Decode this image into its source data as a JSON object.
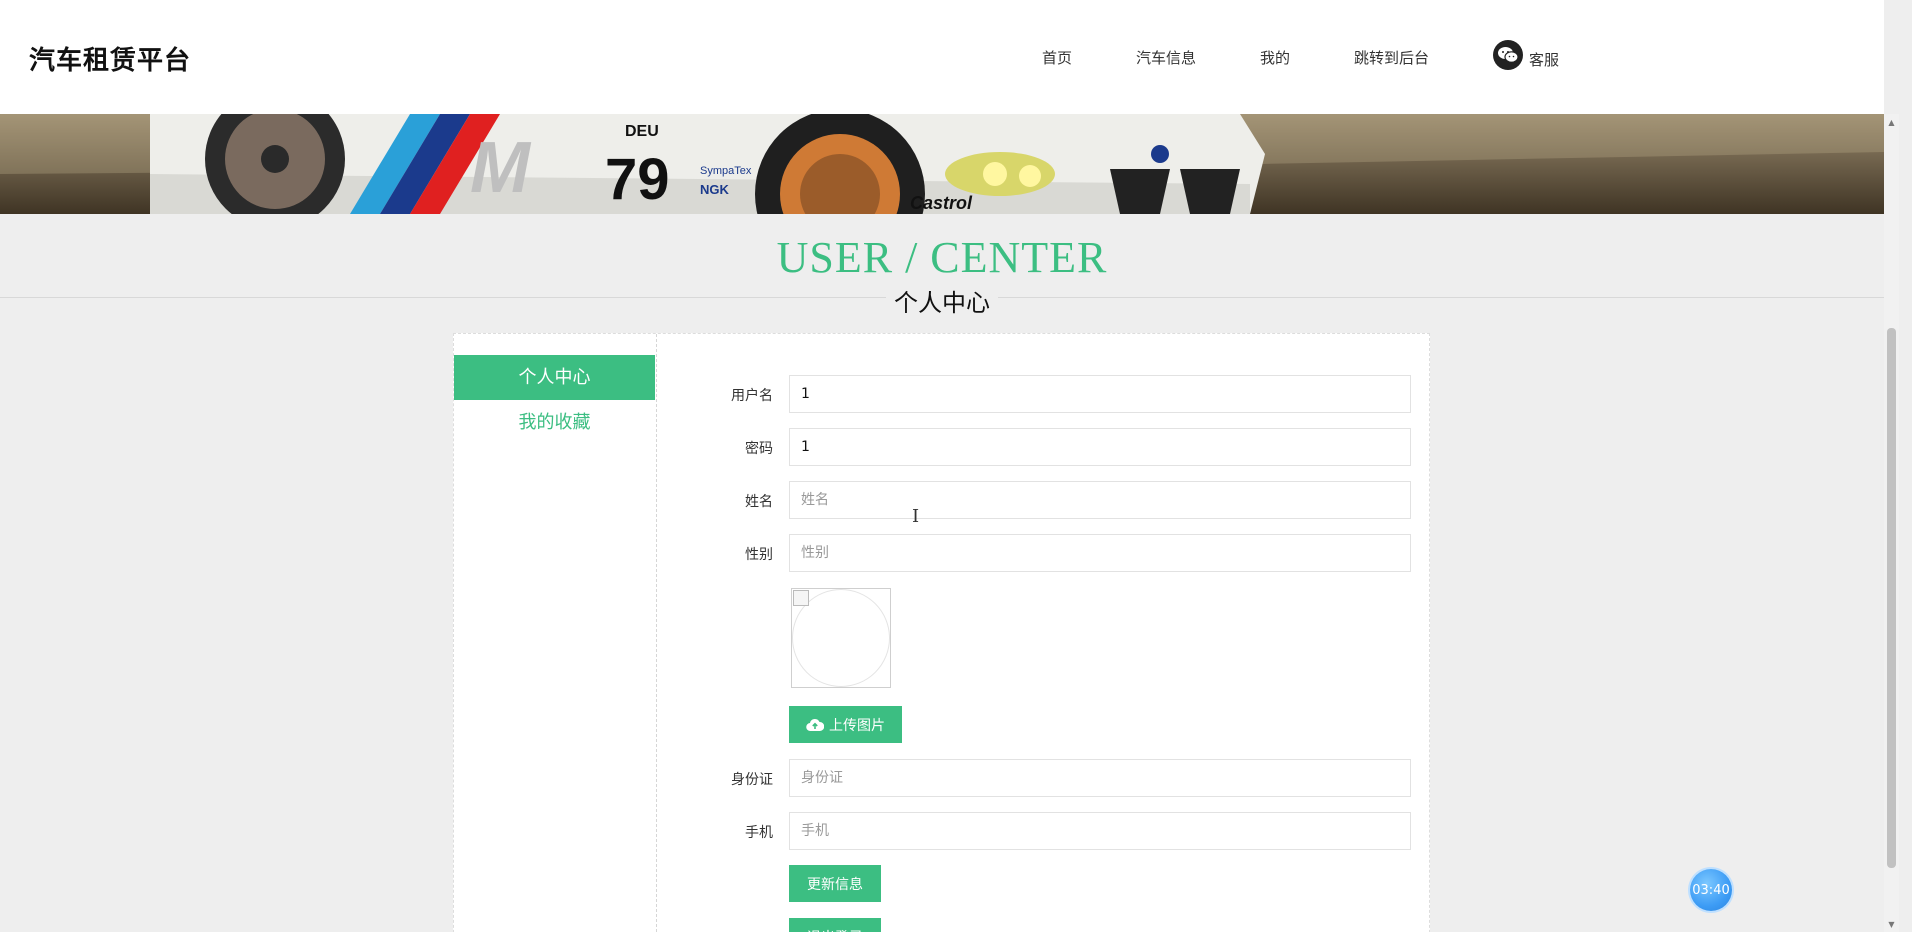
{
  "header": {
    "brand": "汽车租赁平台",
    "nav": [
      {
        "label": "首页"
      },
      {
        "label": "汽车信息"
      },
      {
        "label": "我的"
      },
      {
        "label": "跳转到后台"
      }
    ],
    "customer_service": {
      "label": "客服",
      "icon": "wechat-icon"
    }
  },
  "heading": {
    "english": "USER / CENTER",
    "chinese": "个人中心"
  },
  "sidebar": {
    "items": [
      {
        "label": "个人中心",
        "active": true
      },
      {
        "label": "我的收藏",
        "active": false
      }
    ]
  },
  "form": {
    "username": {
      "label": "用户名",
      "value": "1"
    },
    "password": {
      "label": "密码",
      "value": "1"
    },
    "name": {
      "label": "姓名",
      "value": "",
      "placeholder": "姓名"
    },
    "gender": {
      "label": "性别",
      "value": "",
      "placeholder": "性别"
    },
    "upload_button": "上传图片",
    "id_card": {
      "label": "身份证",
      "value": "",
      "placeholder": "身份证"
    },
    "phone": {
      "label": "手机",
      "value": "",
      "placeholder": "手机"
    },
    "update_button": "更新信息",
    "logout_button": "退出登录"
  },
  "timer": {
    "value": "03:40"
  },
  "colors": {
    "accent": "#3cbe82",
    "background": "#eeeeee",
    "header_bg": "#ffffff",
    "timer": "#3d9cf5"
  }
}
